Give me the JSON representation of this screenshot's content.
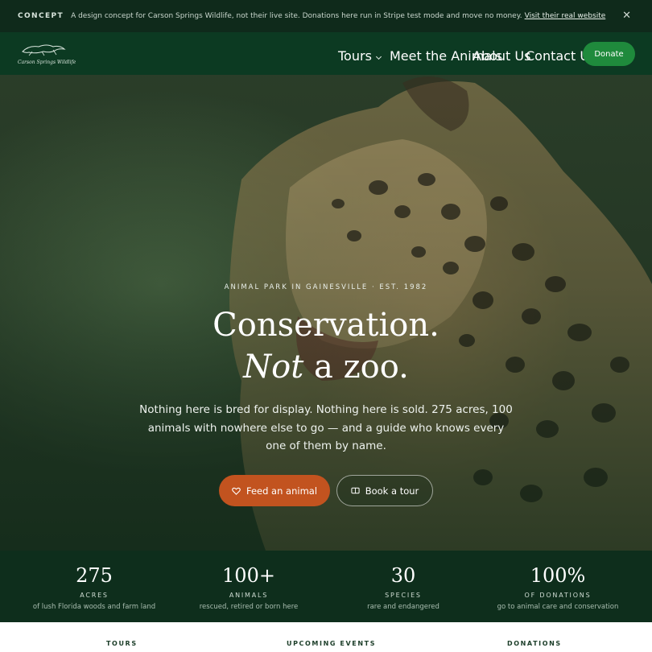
{
  "banner": {
    "tag": "CONCEPT",
    "message": "A design concept for Carson Springs Wildlife, not their live site. Donations here run in Stripe test mode and move no money.",
    "link_text": "Visit their real website",
    "close_icon": "close-icon"
  },
  "nav": {
    "logo_text": "Carson Springs Wildlife",
    "items": [
      {
        "label": "Tours",
        "has_dropdown": true
      },
      {
        "label": "Meet the Animals"
      },
      {
        "label": "About Us"
      },
      {
        "label": "Contact Us"
      }
    ],
    "donate_label": "Donate"
  },
  "hero": {
    "kicker": "ANIMAL PARK IN GAINESVILLE · EST. 1982",
    "headline_line1": "Conservation.",
    "headline_line2_em": "Not",
    "headline_line2_rest": " a zoo.",
    "subtitle": "Nothing here is bred for display. Nothing here is sold. 275 acres, 100 animals with nowhere else to go — and a guide who knows every one of them by name.",
    "primary_button": {
      "label": "Feed an animal",
      "icon": "heart-icon"
    },
    "secondary_button": {
      "label": "Book a tour",
      "icon": "ticket-icon"
    }
  },
  "stats": [
    {
      "value": "275",
      "label": "ACRES",
      "desc": "of lush Florida woods and farm land"
    },
    {
      "value": "100+",
      "label": "ANIMALS",
      "desc": "rescued, retired or born here"
    },
    {
      "value": "30",
      "label": "SPECIES",
      "desc": "rare and endangered"
    },
    {
      "value": "100%",
      "label": "OF DONATIONS",
      "desc": "go to animal care and conservation"
    }
  ],
  "sections": [
    "TOURS",
    "UPCOMING EVENTS",
    "DONATIONS"
  ],
  "colors": {
    "banner_bg": "#0f2a1b",
    "nav_bg": "#0c3a22",
    "donate": "#1f8a3c",
    "feed_button": "#c2531f",
    "stats_bg": "#0e2e1c"
  }
}
